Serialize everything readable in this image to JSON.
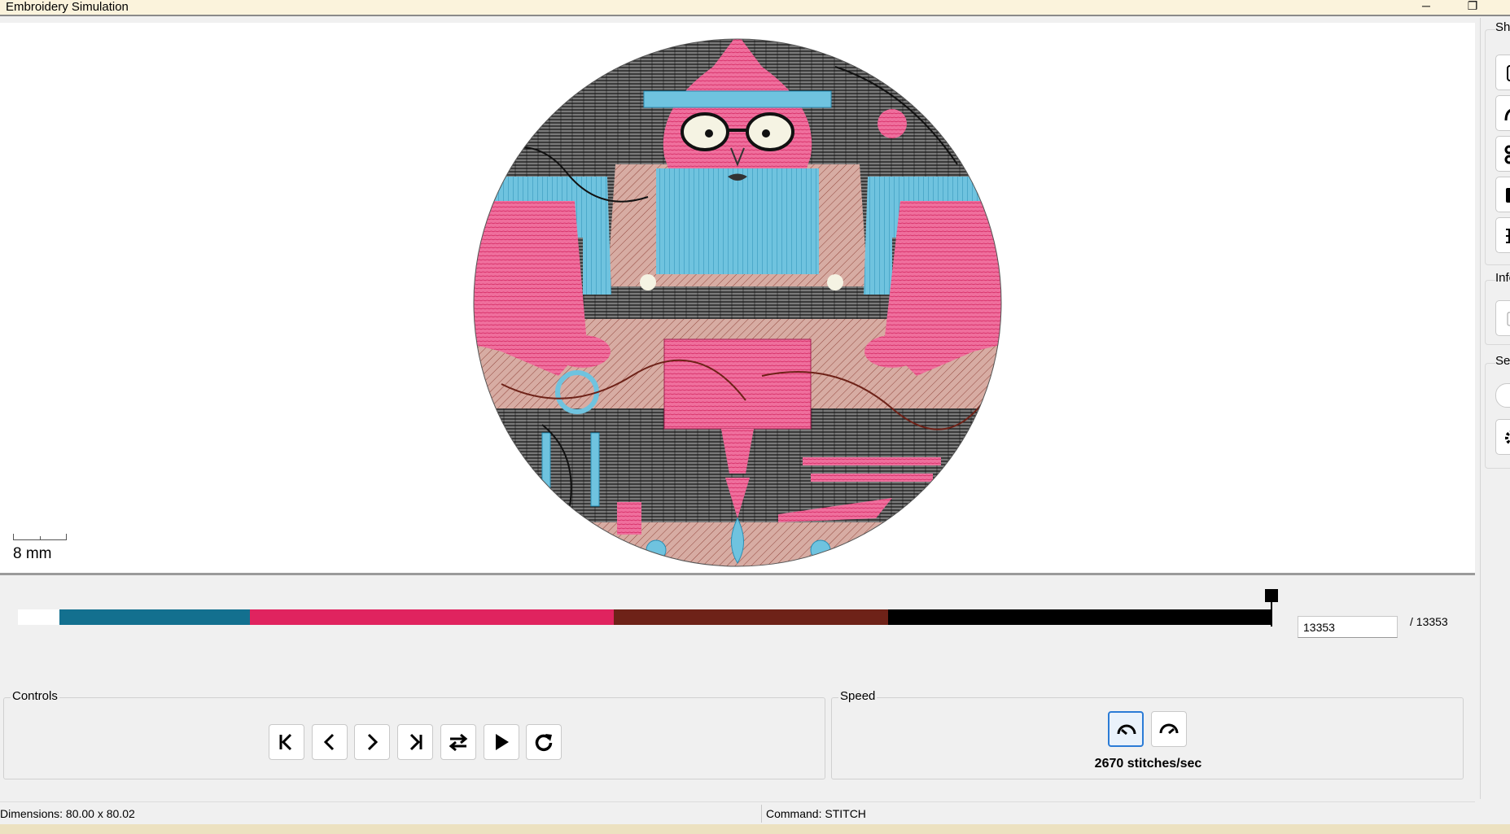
{
  "window": {
    "title": "Embroidery Simulation",
    "minimize_glyph": "─",
    "restore_glyph": "❐"
  },
  "canvas": {
    "scale_label": "8 mm"
  },
  "right_panel": {
    "groups": [
      {
        "legend": "Sho"
      },
      {
        "legend": "Info"
      },
      {
        "legend": "Sett"
      }
    ]
  },
  "timeline": {
    "current_stitch": "13353",
    "total_label": "/ 13353",
    "total_stitches": 13353,
    "position_fraction": 1.0,
    "color_blocks": [
      {
        "color": "#ffffff",
        "fraction": 0.033
      },
      {
        "color": "#13708f",
        "fraction": 0.152
      },
      {
        "color": "#e0235f",
        "fraction": 0.29
      },
      {
        "color": "#6e2218",
        "fraction": 0.219
      },
      {
        "color": "#000000",
        "fraction": 0.306
      }
    ]
  },
  "controls": {
    "legend": "Controls",
    "buttons": [
      {
        "name": "first-stitch-button",
        "icon": "skip-start-icon"
      },
      {
        "name": "step-back-button",
        "icon": "chevron-left-icon"
      },
      {
        "name": "step-forward-button",
        "icon": "chevron-right-icon"
      },
      {
        "name": "last-stitch-button",
        "icon": "skip-end-icon"
      },
      {
        "name": "toggle-direction-button",
        "icon": "swap-arrows-icon"
      },
      {
        "name": "play-button",
        "icon": "play-icon"
      },
      {
        "name": "restart-button",
        "icon": "refresh-icon"
      }
    ]
  },
  "speed": {
    "legend": "Speed",
    "slower_icon": "speed-slow-icon",
    "faster_icon": "speed-fast-icon",
    "label": "2670 stitches/sec"
  },
  "status": {
    "dimensions": "Dimensions: 80.00 x 80.02",
    "command": "Command: STITCH"
  },
  "colors": {
    "thread_blue": "#55b5d6",
    "thread_pink": "#ef5a90",
    "thread_brown": "#a0403a",
    "thread_black": "#111111",
    "focus_blue": "#2b7bd6"
  }
}
